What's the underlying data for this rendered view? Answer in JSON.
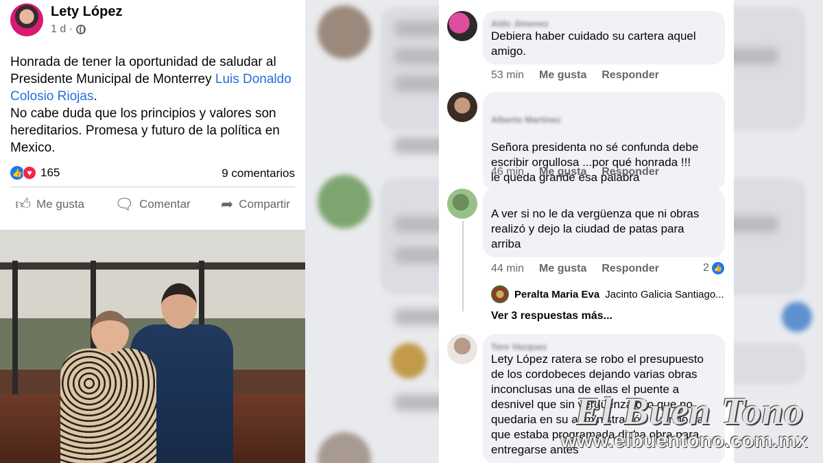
{
  "post": {
    "author": "Lety López",
    "time": "1 d ·",
    "privacy_icon": "globe-icon",
    "text_before_link": "Honrada de tener la oportunidad de saludar al Presidente Municipal de Monterrey ",
    "link_text": "Luis Donaldo Colosio Riojas",
    "text_after_link": ".",
    "text_line2": "No cabe duda que los principios y valores son hereditarios. Promesa y futuro de la política en Mexico.",
    "reaction_count": "165",
    "comment_count": "9 comentarios",
    "actions": {
      "like": "Me gusta",
      "comment": "Comentar",
      "share": "Compartir"
    }
  },
  "comments": [
    {
      "text": "Debiera haber cuidado su cartera aquel amigo.",
      "time": "53 min",
      "like": "Me gusta",
      "reply": "Responder"
    },
    {
      "text": "Señora presidenta  no sé confunda debe escribir orgullosa ...por qué honrada !!!\n le queda grande esa palabra",
      "time": "46 min",
      "like": "Me gusta",
      "reply": "Responder"
    },
    {
      "text": "A ver si no le da vergüenza que ni obras realizó y dejo la ciudad de patas para arriba",
      "time": "44 min",
      "like": "Me gusta",
      "reply": "Responder",
      "reactions": "2"
    },
    {
      "text": "Lety López ratera se robo el presupuesto de los cordobeces dejando varias obras inconclusas una de ellas el puente a desnivel que sin vergüenza dijo que no quedaria en su administración cuando ya que estaba programada dicha obra para entregarse antes"
    }
  ],
  "reply_preview": {
    "name": "Peralta Maria Eva",
    "text": "Jacinto Galicia Santiago..."
  },
  "more_replies": "Ver 3 respuestas más...",
  "watermark": {
    "logo": "El Buen Tono",
    "url": "www.elbuentono.com.mx"
  },
  "colors": {
    "link": "#216fdb",
    "like_blue": "#1877f2",
    "love_red": "#f02849",
    "bubble": "#f0f2f5"
  }
}
